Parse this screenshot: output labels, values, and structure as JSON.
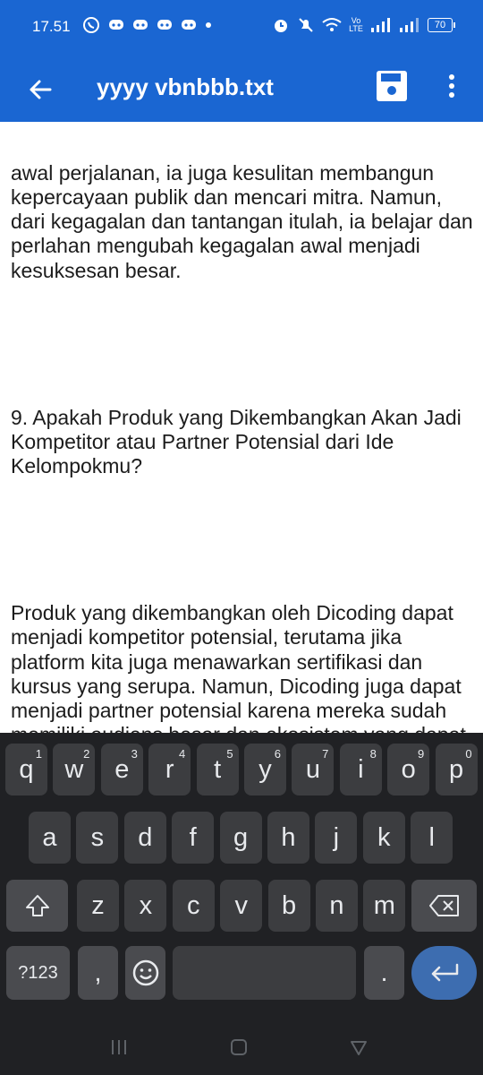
{
  "status_bar": {
    "time": "17.51",
    "network_label": "Vo LTE",
    "battery": "70"
  },
  "app_bar": {
    "title": "yyyy vbnbbb.txt"
  },
  "document": {
    "paragraphs": [
      "awal perjalanan, ia juga kesulitan membangun kepercayaan publik dan mencari mitra. Namun, dari kegagalan dan tantangan itulah, ia belajar dan perlahan mengubah kegagalan awal menjadi kesuksesan besar.",
      "9. Apakah Produk yang Dikembangkan Akan Jadi Kompetitor atau Partner Potensial dari Ide Kelompokmu?",
      "Produk yang dikembangkan oleh Dicoding dapat menjadi kompetitor potensial, terutama jika platform kita juga menawarkan sertifikasi dan kursus yang serupa. Namun, Dicoding juga dapat menjadi partner potensial karena mereka sudah memiliki audiens besar dan ekosistem yang dapat membantu kita memperluas jangkauan. Kita juga dapat kerja sama dalam hal konten promsi dalam pemasaran dan bagaimana cara meyakinkan user atau pengguna serta kita juga kerja sama dalam pelatihan atau sertifikasi mungkin bisa saling menguntungkan."
    ]
  },
  "keyboard": {
    "row1": [
      {
        "key": "q",
        "hint": "1"
      },
      {
        "key": "w",
        "hint": "2"
      },
      {
        "key": "e",
        "hint": "3"
      },
      {
        "key": "r",
        "hint": "4"
      },
      {
        "key": "t",
        "hint": "5"
      },
      {
        "key": "y",
        "hint": "6"
      },
      {
        "key": "u",
        "hint": "7"
      },
      {
        "key": "i",
        "hint": "8"
      },
      {
        "key": "o",
        "hint": "9"
      },
      {
        "key": "p",
        "hint": "0"
      }
    ],
    "row2": [
      "a",
      "s",
      "d",
      "f",
      "g",
      "h",
      "j",
      "k",
      "l"
    ],
    "row3": [
      "z",
      "x",
      "c",
      "v",
      "b",
      "n",
      "m"
    ],
    "symbols_label": "?123",
    "comma_label": ",",
    "period_label": "."
  },
  "colors": {
    "app_bar": "#1a66d2",
    "keyboard_bg": "#202124",
    "key_bg": "#3c3d40",
    "enter_key": "#3d6db0"
  }
}
